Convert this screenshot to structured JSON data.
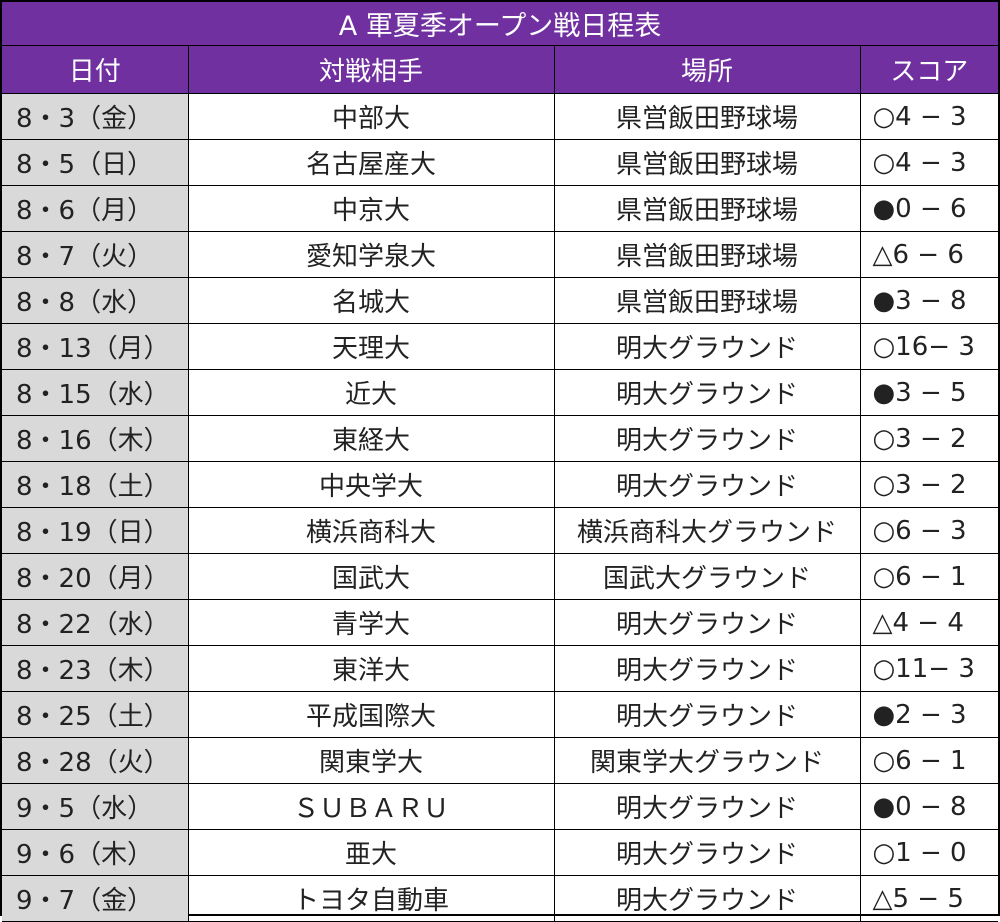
{
  "title": "A 軍夏季オープン戦日程表",
  "headers": [
    "日付",
    "対戦相手",
    "場所",
    "スコア"
  ],
  "rows": [
    {
      "date": "8・3（金）",
      "opponent": "中部大",
      "venue": "県営飯田野球場",
      "score": "○4 − 3"
    },
    {
      "date": "8・5（日）",
      "opponent": "名古屋産大",
      "venue": "県営飯田野球場",
      "score": "○4 − 3"
    },
    {
      "date": "8・6（月）",
      "opponent": "中京大",
      "venue": "県営飯田野球場",
      "score": "●0 − 6"
    },
    {
      "date": "8・7（火）",
      "opponent": "愛知学泉大",
      "venue": "県営飯田野球場",
      "score": "△6 − 6"
    },
    {
      "date": "8・8（水）",
      "opponent": "名城大",
      "venue": "県営飯田野球場",
      "score": "●3 − 8"
    },
    {
      "date": "8・13（月）",
      "opponent": "天理大",
      "venue": "明大グラウンド",
      "score": "○16− 3"
    },
    {
      "date": "8・15（水）",
      "opponent": "近大",
      "venue": "明大グラウンド",
      "score": "●3 − 5"
    },
    {
      "date": "8・16（木）",
      "opponent": "東経大",
      "venue": "明大グラウンド",
      "score": "○3 − 2"
    },
    {
      "date": "8・18（土）",
      "opponent": "中央学大",
      "venue": "明大グラウンド",
      "score": "○3 − 2"
    },
    {
      "date": "8・19（日）",
      "opponent": "横浜商科大",
      "venue": "横浜商科大グラウンド",
      "score": "○6 − 3"
    },
    {
      "date": "8・20（月）",
      "opponent": "国武大",
      "venue": "国武大グラウンド",
      "score": "○6 − 1"
    },
    {
      "date": "8・22（水）",
      "opponent": "青学大",
      "venue": "明大グラウンド",
      "score": "△4 − 4"
    },
    {
      "date": "8・23（木）",
      "opponent": "東洋大",
      "venue": "明大グラウンド",
      "score": "○11− 3"
    },
    {
      "date": "8・25（土）",
      "opponent": "平成国際大",
      "venue": "明大グラウンド",
      "score": "●2 − 3"
    },
    {
      "date": "8・28（火）",
      "opponent": "関東学大",
      "venue": "関東学大グラウンド",
      "score": "○6 − 1"
    },
    {
      "date": "9・5（水）",
      "opponent": "ＳＵＢＡＲＵ",
      "venue": "明大グラウンド",
      "score": "●0 − 8"
    },
    {
      "date": "9・6（木）",
      "opponent": "亜大",
      "venue": "明大グラウンド",
      "score": "○1 − 0"
    },
    {
      "date": "9・7（金）",
      "opponent": "トヨタ自動車",
      "venue": "明大グラウンド",
      "score": "△5 − 5"
    }
  ],
  "colors": {
    "header_bg": "#7030a0",
    "header_text": "#ffffff",
    "date_bg": "#d9d9d9"
  }
}
